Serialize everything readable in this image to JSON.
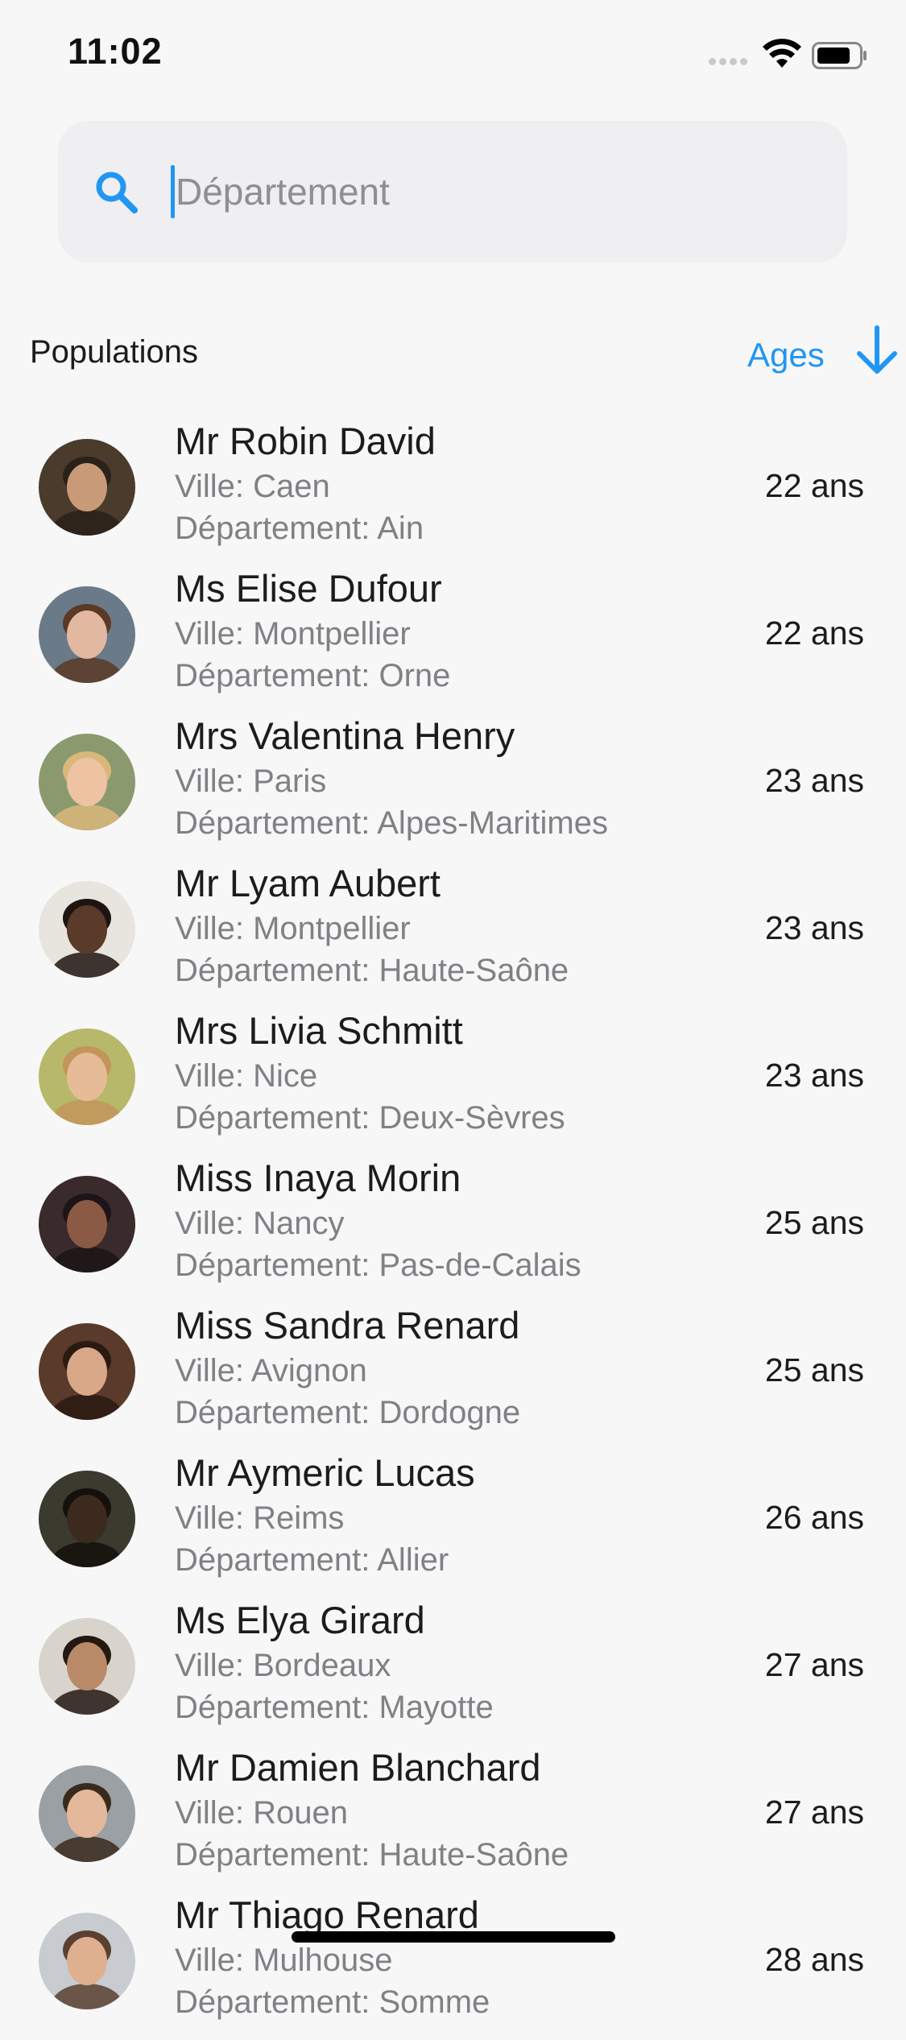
{
  "status_bar": {
    "time": "11:02"
  },
  "search": {
    "placeholder": "Département",
    "value": ""
  },
  "header": {
    "title": "Populations",
    "sort_label": "Ages"
  },
  "colors": {
    "accent": "#2196f3",
    "secondary_text": "#808085",
    "background": "#f7f7f8"
  },
  "people": [
    {
      "name": "Mr Robin David",
      "city": "Ville: Caen",
      "department": "Département: Ain",
      "age": "22 ans",
      "avatar": {
        "bg": "#4a3b2c",
        "skin": "#c99a78",
        "hair": "#2a211a"
      }
    },
    {
      "name": "Ms Elise Dufour",
      "city": "Ville: Montpellier",
      "department": "Département: Orne",
      "age": "22 ans",
      "avatar": {
        "bg": "#6b7a88",
        "skin": "#e2b8a0",
        "hair": "#5a3a24"
      }
    },
    {
      "name": "Mrs Valentina Henry",
      "city": "Ville: Paris",
      "department": "Département: Alpes-Maritimes",
      "age": "23 ans",
      "avatar": {
        "bg": "#8a9a6e",
        "skin": "#eec3a2",
        "hair": "#d9b77a"
      }
    },
    {
      "name": "Mr Lyam Aubert",
      "city": "Ville: Montpellier",
      "department": "Département: Haute-Saône",
      "age": "23 ans",
      "avatar": {
        "bg": "#e8e4de",
        "skin": "#5a3a28",
        "hair": "#1e1410"
      }
    },
    {
      "name": "Mrs Livia Schmitt",
      "city": "Ville: Nice",
      "department": "Département: Deux-Sèvres",
      "age": "23 ans",
      "avatar": {
        "bg": "#b8b86a",
        "skin": "#e6bc98",
        "hair": "#c2955a"
      }
    },
    {
      "name": "Miss Inaya Morin",
      "city": "Ville: Nancy",
      "department": "Département: Pas-de-Calais",
      "age": "25 ans",
      "avatar": {
        "bg": "#3a2a2c",
        "skin": "#8a5a44",
        "hair": "#1c1416"
      }
    },
    {
      "name": "Miss Sandra Renard",
      "city": "Ville: Avignon",
      "department": "Département: Dordogne",
      "age": "25 ans",
      "avatar": {
        "bg": "#5a3a2a",
        "skin": "#d9a888",
        "hair": "#2a1a12"
      }
    },
    {
      "name": "Mr Aymeric Lucas",
      "city": "Ville: Reims",
      "department": "Département: Allier",
      "age": "26 ans",
      "avatar": {
        "bg": "#3a3a2e",
        "skin": "#3c2a1e",
        "hair": "#14100c"
      }
    },
    {
      "name": "Ms Elya Girard",
      "city": "Ville: Bordeaux",
      "department": "Département: Mayotte",
      "age": "27 ans",
      "avatar": {
        "bg": "#d8d4cc",
        "skin": "#b88a68",
        "hair": "#241812"
      }
    },
    {
      "name": "Mr Damien Blanchard",
      "city": "Ville: Rouen",
      "department": "Département: Haute-Saône",
      "age": "27 ans",
      "avatar": {
        "bg": "#9aa0a4",
        "skin": "#e4b89a",
        "hair": "#3a2a1e"
      }
    },
    {
      "name": "Mr Thiago Renard",
      "city": "Ville: Mulhouse",
      "department": "Département: Somme",
      "age": "28 ans",
      "avatar": {
        "bg": "#c8ccd0",
        "skin": "#deb090",
        "hair": "#5a4030"
      }
    }
  ]
}
